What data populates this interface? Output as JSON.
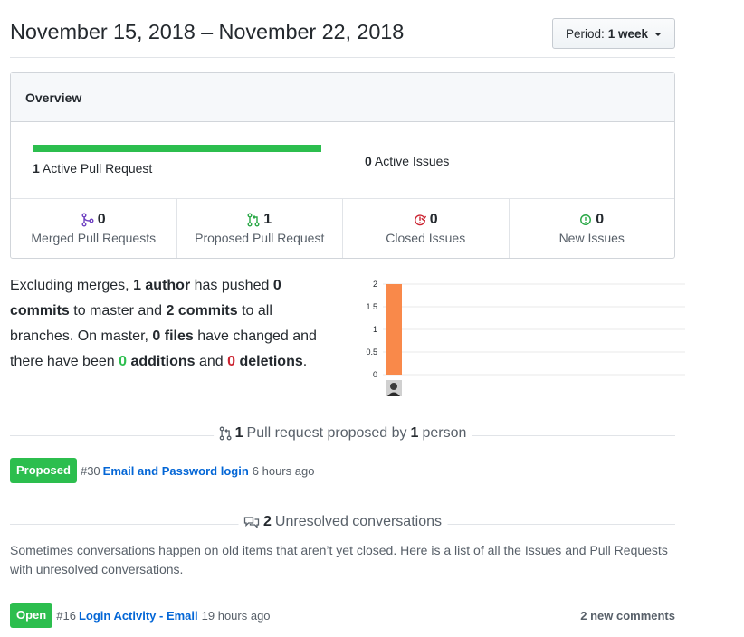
{
  "header": {
    "date_range": "November 15, 2018 – November 22, 2018",
    "period_label": "Period:",
    "period_value": "1 week"
  },
  "overview": {
    "title": "Overview",
    "active_pr_count": "1",
    "active_pr_label": "Active Pull Request",
    "active_issues_count": "0",
    "active_issues_label": "Active Issues",
    "pr_bar_fill_fraction": 1.0,
    "stats": [
      {
        "count": "0",
        "label": "Merged Pull Requests",
        "icon": "git-merge-icon",
        "color": "#6f42c1"
      },
      {
        "count": "1",
        "label": "Proposed Pull Request",
        "icon": "git-pull-request-icon",
        "color": "#28a745"
      },
      {
        "count": "0",
        "label": "Closed Issues",
        "icon": "issue-closed-icon",
        "color": "#cb2431"
      },
      {
        "count": "0",
        "label": "New Issues",
        "icon": "issue-opened-icon",
        "color": "#28a745"
      }
    ]
  },
  "summary": {
    "t1": "Excluding merges, ",
    "authors": "1 author",
    "t2": " has pushed ",
    "commits_master": "0 commits",
    "t3": " to master and ",
    "commits_all": "2 commits",
    "t4": " to all branches. On master, ",
    "files": "0 files",
    "t5": " have changed and there have been ",
    "additions_num": "0",
    "additions_word": " additions",
    "t6": " and ",
    "deletions_num": "0",
    "deletions_word": " deletions",
    "t7": "."
  },
  "chart_data": {
    "type": "bar",
    "categories": [
      "author-avatar"
    ],
    "values": [
      2
    ],
    "ylim": [
      0,
      2
    ],
    "yticks": [
      "0",
      "0.5",
      "1",
      "1.5",
      "2"
    ],
    "grid": true,
    "bar_color": "#f9894a",
    "title": "",
    "xlabel": "",
    "ylabel": ""
  },
  "pull_requests": {
    "count": "1",
    "label_mid": "Pull request proposed by",
    "person_count": "1",
    "label_end": "person",
    "items": [
      {
        "badge": "Proposed",
        "number": "#30",
        "title": "Email and Password login",
        "time": "6 hours ago"
      }
    ]
  },
  "conversations": {
    "count": "2",
    "label": "Unresolved conversations",
    "note": "Sometimes conversations happen on old items that aren’t yet closed. Here is a list of all the Issues and Pull Requests with unresolved conversations.",
    "items": [
      {
        "badge": "Open",
        "number": "#16",
        "title": "Login Activity - Email",
        "time": "19 hours ago",
        "comments": "2 new comments"
      }
    ]
  },
  "colors": {
    "green": "#2cbe4e",
    "red": "#cb2431",
    "link": "#0366d6",
    "bar": "#f9894a"
  }
}
